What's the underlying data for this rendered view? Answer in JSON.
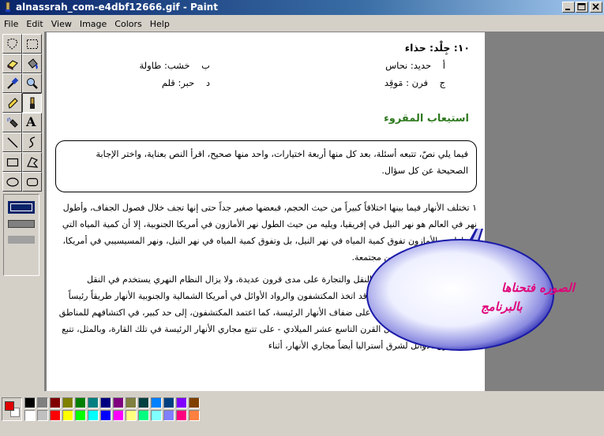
{
  "window": {
    "title": "alnassrah_com-e4dbf12666.gif - Paint",
    "buttons": [
      "minimize",
      "maximize",
      "close"
    ]
  },
  "menus": [
    "File",
    "Edit",
    "View",
    "Image",
    "Colors",
    "Help"
  ],
  "tools": [
    {
      "name": "free-form-select-icon"
    },
    {
      "name": "select-icon"
    },
    {
      "name": "eraser-icon"
    },
    {
      "name": "fill-bucket-icon"
    },
    {
      "name": "pick-color-icon"
    },
    {
      "name": "magnifier-icon"
    },
    {
      "name": "pencil-icon"
    },
    {
      "name": "brush-icon"
    },
    {
      "name": "airbrush-icon"
    },
    {
      "name": "text-icon",
      "glyph": "A"
    },
    {
      "name": "line-icon"
    },
    {
      "name": "curve-icon"
    },
    {
      "name": "rectangle-icon"
    },
    {
      "name": "polygon-icon"
    },
    {
      "name": "ellipse-icon"
    },
    {
      "name": "rounded-rectangle-icon"
    }
  ],
  "document": {
    "question": "١٠: جِلْد: حذاء",
    "options": [
      {
        "letter": "أ",
        "text": "حديد: نحاس"
      },
      {
        "letter": "ب",
        "text": "خشب: طاولة"
      },
      {
        "letter": "ج",
        "text": "فرن : مَوقِد"
      },
      {
        "letter": "د",
        "text": "حبر: قلم"
      }
    ],
    "heading": "استيعاب المقروء",
    "instructions": "فيما يلي نصّ، تتبعه أسئلة، بعد كل منها أربعة اختيارات، واحد منها صحيح، اقرأ النص بعناية، واختر الإجابة الصحيحة عن كل سؤال.",
    "paragraph1": "١ تختلف الأنهار فيما بينها اختلافاً كبيراً من حيث الحجم، فبعضها صغير جداً حتى إنها تجف خلال فصول الجفاف، وأطول نهر في العالم هو نهر النيل في إفريقيا، ويليه من حيث الطول نهر الأمازون في أمريكا الجنوبية، إلا أن كمية المياه التي يحملها نهر الأمازون تفوق كمية المياه في نهر النيل، بل وتفوق كمية المياه في نهر النيل، ونهر المسيسيبي في أمريكا، ونهر اليانجستي في الصين مجتمعة.",
    "paragraph2": "٢ استخدمت الأنهار قديماً في النقل والتجارة على مدى قرون عديدة، ولا يزال النظام النهري يستخدم في النقل والتجارة حتى الوقت الحاضر، وقد اتخذ المكتشفون والرواد الأوائل في أمريكا الشمالية والجنوبية الأنهار طريقاً رئيساً لأسفارهم، وبنوا المستوطنات على ضفاف الأنهار الرئيسة، كما اعتمد المكتشفون، إلى حد كبير، في اكتشافهم للمناطق الداخلية من إفريقيا - خلال القرن التاسع عشر الميلادي - على تتبع مجاري الأنهار الرئيسة في تلك القارة، وبالمثل، تتبع المكتشفون الأوائل لشرق أستراليا أيضاً مجاري الأنهار، أثناء"
  },
  "bubble": {
    "line1": "الصوره فتحناها",
    "line2": "بالبرنامج",
    "fill": "#1a1aa8",
    "text_color": "#e0007a"
  },
  "palette": {
    "foreground": "#000000",
    "background": "#ffffff",
    "top": [
      "#000000",
      "#808080",
      "#800000",
      "#808000",
      "#008000",
      "#008080",
      "#000080",
      "#800080",
      "#808040",
      "#004040",
      "#0080ff",
      "#004080",
      "#8000ff",
      "#804000"
    ],
    "bottom": [
      "#ffffff",
      "#c0c0c0",
      "#ff0000",
      "#ffff00",
      "#00ff00",
      "#00ffff",
      "#0000ff",
      "#ff00ff",
      "#ffff80",
      "#00ff80",
      "#80ffff",
      "#8080ff",
      "#ff0080",
      "#ff8040"
    ]
  }
}
